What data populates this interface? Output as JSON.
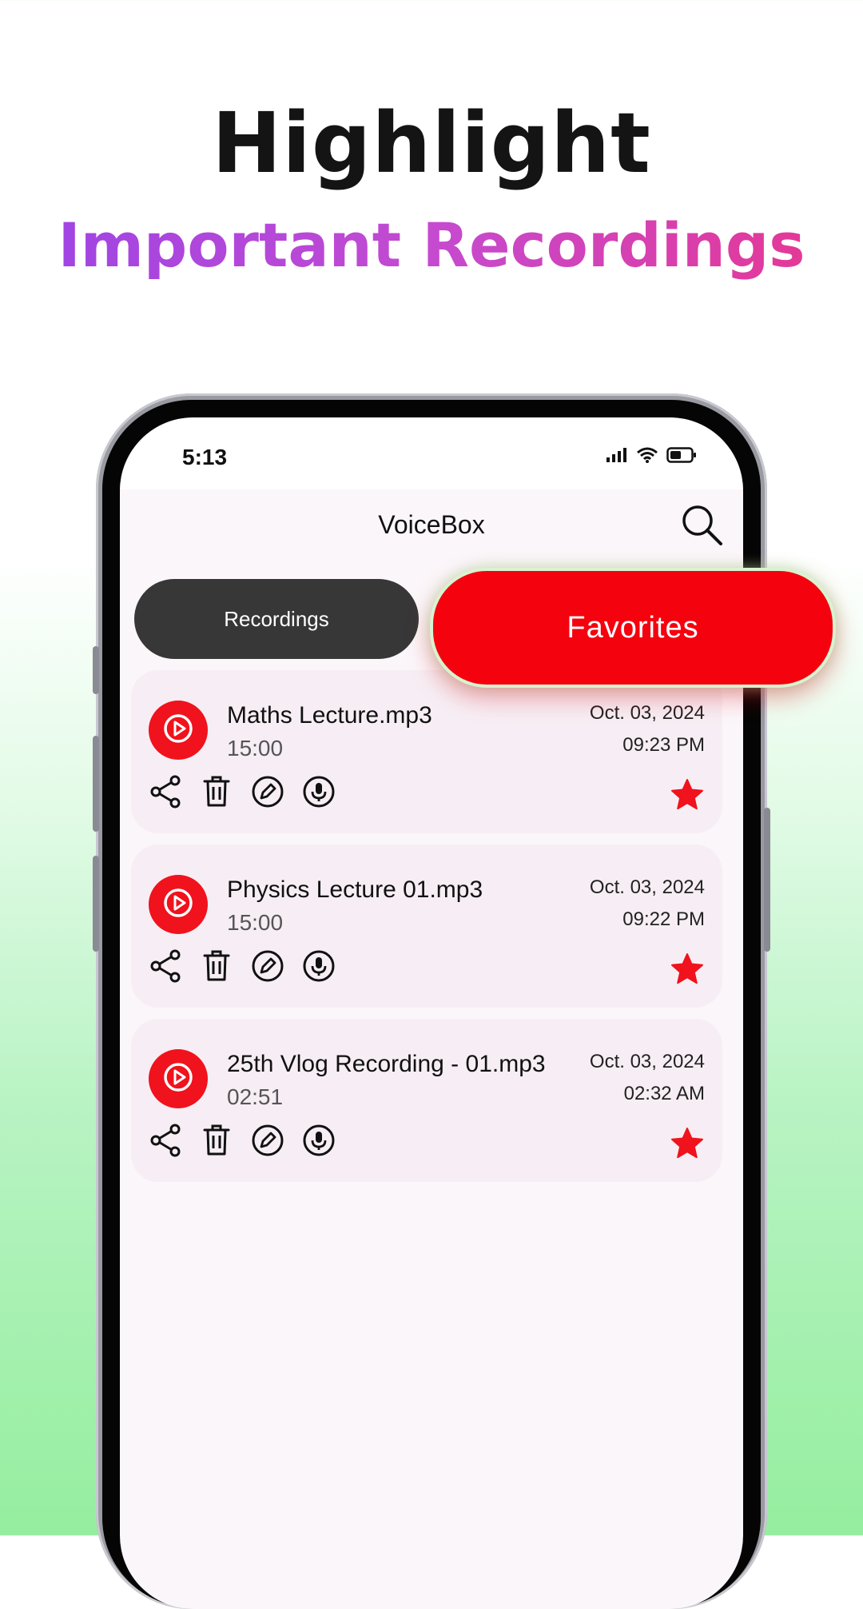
{
  "promo": {
    "headline": "Highlight",
    "subheadline": "Important Recordings"
  },
  "status_bar": {
    "time": "5:13",
    "icons": [
      "signal-icon",
      "wifi-icon",
      "battery-icon"
    ]
  },
  "app": {
    "title": "VoiceBox",
    "search_icon": "search-icon"
  },
  "tabs": {
    "recordings": "Recordings",
    "favorites": "Favorites",
    "active": "favorites"
  },
  "recordings": [
    {
      "name": "Maths Lecture.mp3",
      "duration": "15:00",
      "date": "Oct. 03, 2024",
      "time": "09:23 PM",
      "favorite": true
    },
    {
      "name": "Physics Lecture 01.mp3",
      "duration": "15:00",
      "date": "Oct. 03, 2024",
      "time": "09:22 PM",
      "favorite": true
    },
    {
      "name": "25th Vlog Recording - 01.mp3",
      "duration": "02:51",
      "date": "Oct. 03, 2024",
      "time": "02:32 AM",
      "favorite": true
    }
  ],
  "card_actions": [
    "share-icon",
    "delete-icon",
    "edit-icon",
    "voice-icon"
  ],
  "colors": {
    "accent_red": "#f5020f",
    "play_red": "#f0121c",
    "tab_dark": "#373737",
    "gradient_start": "#9b44e6",
    "gradient_end": "#e8368f"
  }
}
